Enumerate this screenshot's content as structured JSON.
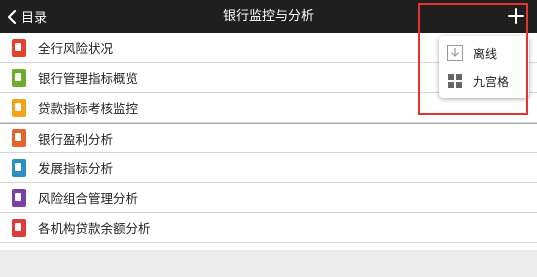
{
  "header": {
    "back_label": "目录",
    "title": "银行监控与分析"
  },
  "list": {
    "items": [
      {
        "label": "全行风险状况",
        "color": "#e5412e"
      },
      {
        "label": "银行管理指标概览",
        "color": "#6cad2b"
      },
      {
        "label": "贷款指标考核监控",
        "color": "#f5a219"
      },
      {
        "label": "银行盈利分析",
        "color": "#e6622b"
      },
      {
        "label": "发展指标分析",
        "color": "#2b8fbf"
      },
      {
        "label": "风险组合管理分析",
        "color": "#7d3fa7"
      },
      {
        "label": "各机构贷款余额分析",
        "color": "#e03b3b"
      }
    ]
  },
  "menu": {
    "offline_label": "离线",
    "grid_label": "九宫格"
  },
  "colors": {
    "topbar": "#1f1f1f",
    "highlight": "#e8322e"
  }
}
